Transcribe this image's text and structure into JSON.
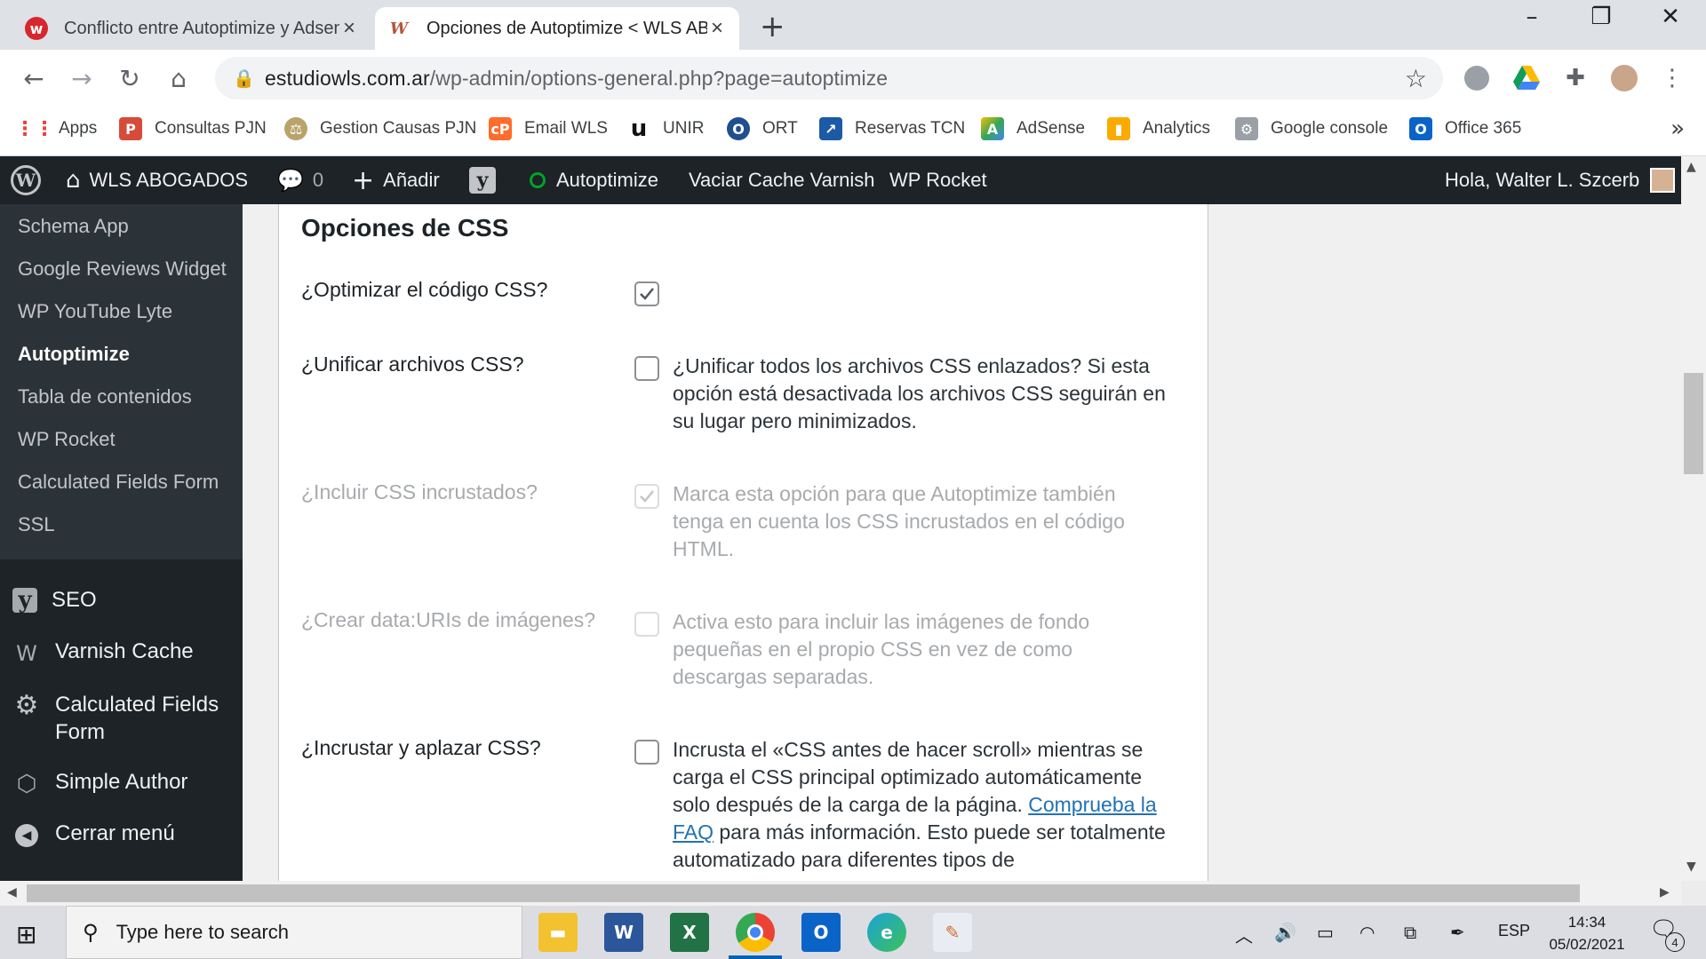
{
  "browser": {
    "tabs": [
      {
        "title": "Conflicto entre Autoptimize y Adsense",
        "favicon": "red-w-icon",
        "active": false
      },
      {
        "title": "Opciones de Autoptimize < WLS ABOGADOS",
        "favicon": "wls-logo-icon",
        "active": true
      }
    ],
    "new_tab": "+",
    "url_host": "estudiowls.com.ar",
    "url_path": "/wp-admin/options-general.php?page=autoptimize",
    "bookmarks": [
      {
        "label": "Apps",
        "icon": "apps-grid-icon"
      },
      {
        "label": "Consultas PJN",
        "icon": "pjn-icon"
      },
      {
        "label": "Gestion Causas PJN",
        "icon": "gestion-icon"
      },
      {
        "label": "Email WLS",
        "icon": "email-icon"
      },
      {
        "label": "UNIR",
        "icon": "unir-icon"
      },
      {
        "label": "ORT",
        "icon": "ort-icon"
      },
      {
        "label": "Reservas TCN",
        "icon": "reservas-icon"
      },
      {
        "label": "AdSense",
        "icon": "adsense-icon"
      },
      {
        "label": "Analytics",
        "icon": "analytics-icon"
      },
      {
        "label": "Google console",
        "icon": "console-icon"
      },
      {
        "label": "Office 365",
        "icon": "outlook-icon"
      }
    ],
    "bookmarks_more": "»"
  },
  "adminbar": {
    "site_name": "WLS ABOGADOS",
    "comments_count": "0",
    "add_label": "Añadir",
    "autoptimize": "Autoptimize",
    "varnish": "Vaciar Cache Varnish",
    "wprocket": "WP Rocket",
    "greeting": "Hola, Walter L. Szcerb"
  },
  "sidebar": {
    "submenu": [
      {
        "label": "Schema App",
        "current": false
      },
      {
        "label": "Google Reviews Widget",
        "current": false
      },
      {
        "label": "WP YouTube Lyte",
        "current": false
      },
      {
        "label": "Autoptimize",
        "current": true
      },
      {
        "label": "Tabla de contenidos",
        "current": false
      },
      {
        "label": "WP Rocket",
        "current": false
      },
      {
        "label": "Calculated Fields Form",
        "current": false
      },
      {
        "label": "SSL",
        "current": false
      }
    ],
    "main": [
      {
        "label": "SEO",
        "icon": "yoast-icon"
      },
      {
        "label": "Varnish Cache",
        "icon": "varnish-icon"
      },
      {
        "label": "Calculated Fields Form",
        "icon": "gear-icon"
      },
      {
        "label": "Simple Author",
        "icon": "simple-author-icon"
      },
      {
        "label": "Cerrar menú",
        "icon": "collapse-arrow-icon"
      }
    ]
  },
  "content": {
    "heading": "Opciones de CSS",
    "options": [
      {
        "label": "¿Optimizar el código CSS?",
        "checked": true,
        "disabled": false,
        "desc": ""
      },
      {
        "label": "¿Unificar archivos CSS?",
        "checked": false,
        "disabled": false,
        "desc": "¿Unificar todos los archivos CSS enlazados? Si esta opción está desactivada los archivos CSS seguirán en su lugar pero minimizados."
      },
      {
        "label": "¿Incluir CSS incrustados?",
        "checked": true,
        "disabled": true,
        "desc": "Marca esta opción para que Autoptimize también tenga en cuenta los CSS incrustados en el código HTML."
      },
      {
        "label": "¿Crear data:URIs de imágenes?",
        "checked": false,
        "disabled": true,
        "desc": "Activa esto para incluir las imágenes de fondo pequeñas en el propio CSS en vez de como descargas separadas."
      },
      {
        "label": "¿Incrustar y aplazar CSS?",
        "checked": false,
        "disabled": false,
        "desc_before": "Incrusta el «CSS antes de hacer scroll» mientras se carga el CSS principal optimizado automáticamente solo después de la carga de la página.",
        "desc_link": "Comprueba la FAQ",
        "desc_after": "para más información. Esto puede ser totalmente automatizado para diferentes tipos de"
      }
    ]
  },
  "taskbar": {
    "search_placeholder": "Type here to search",
    "lang": "ESP",
    "time": "14:34",
    "date": "05/02/2021",
    "notifications": "4"
  },
  "colors": {
    "admin_bar": "#1d2327",
    "submenu_bg": "#2c3338",
    "link": "#2271b1",
    "disabled_text": "#a7aaad",
    "autoptimize_status": "#00a32a"
  }
}
